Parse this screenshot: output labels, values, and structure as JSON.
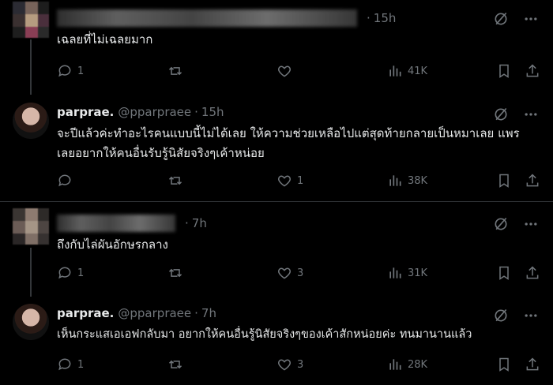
{
  "tweets": [
    {
      "name": "",
      "time": "15h",
      "text": "เฉลยที่ไม่เฉลยมาก",
      "replies": "1",
      "retweets": "",
      "likes": "",
      "views": "41K"
    },
    {
      "name": "parprae.",
      "handle": "@pparpraee",
      "time": "15h",
      "text": "จะปีแล้วค่ะทำอะไรคนแบบนี้ไม่ได้เลย ให้ความช่วยเหลือไปแต่สุดท้ายกลายเป็นหมาเลย แพรเลยอยากให้คนอื่นรับรู้นิสัยจริงๆเค้าหน่อย",
      "replies": "",
      "retweets": "",
      "likes": "1",
      "views": "38K"
    },
    {
      "name": "",
      "time": "7h",
      "text": "ถึงกับไล่ผันอักษรกลาง",
      "replies": "1",
      "retweets": "",
      "likes": "3",
      "views": "31K"
    },
    {
      "name": "parprae.",
      "handle": "@pparpraee",
      "time": "7h",
      "text": "เห็นกระแสเอเอฟกลับมา อยากให้คนอื่นรู้นิสัยจริงๆของเค้าสักหน่อยค่ะ ทนมานานแล้ว",
      "replies": "1",
      "retweets": "",
      "likes": "3",
      "views": "28K"
    }
  ],
  "separator": "·",
  "icons": {
    "reply": "reply-icon",
    "retweet": "retweet-icon",
    "like": "heart-icon",
    "views": "views-icon",
    "bookmark": "bookmark-icon",
    "share": "share-icon",
    "grok": "grok-icon",
    "more": "more-icon"
  }
}
